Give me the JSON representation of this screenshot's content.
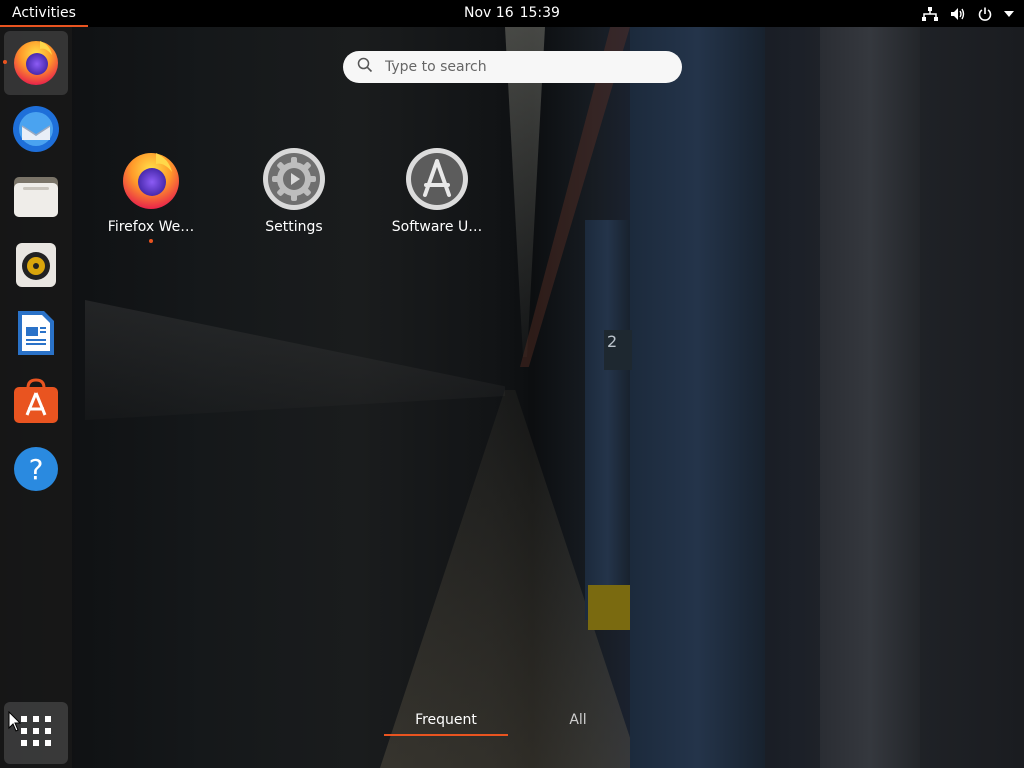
{
  "topbar": {
    "activities_label": "Activities",
    "date": "Nov 16",
    "time": "15:39",
    "status_icons": [
      "network-icon",
      "volume-icon",
      "power-icon",
      "menu-arrow-icon"
    ]
  },
  "dock": {
    "items": [
      {
        "name": "firefox",
        "icon": "firefox-icon",
        "running": true
      },
      {
        "name": "thunderbird",
        "icon": "thunderbird-icon",
        "running": false
      },
      {
        "name": "files",
        "icon": "files-icon",
        "running": false
      },
      {
        "name": "rhythmbox",
        "icon": "rhythmbox-icon",
        "running": false
      },
      {
        "name": "libreoffice-writer",
        "icon": "libreoffice-writer-icon",
        "running": false
      },
      {
        "name": "ubuntu-software",
        "icon": "software-icon",
        "running": false
      },
      {
        "name": "help",
        "icon": "help-icon",
        "running": false
      }
    ],
    "show_apps_icon": "grid-icon"
  },
  "search": {
    "placeholder": "Type to search"
  },
  "apps": [
    {
      "label": "Firefox We…",
      "icon": "firefox-icon",
      "running": true
    },
    {
      "label": "Settings",
      "icon": "settings-icon",
      "running": false
    },
    {
      "label": "Software U…",
      "icon": "software-updater-icon",
      "running": false
    }
  ],
  "tabs": {
    "frequent": "Frequent",
    "all": "All",
    "selected": "frequent"
  },
  "wallpaper_text": {
    "sign": "2"
  },
  "colors": {
    "accent": "#e95420",
    "topbar": "#000000",
    "dock": "#191919"
  }
}
